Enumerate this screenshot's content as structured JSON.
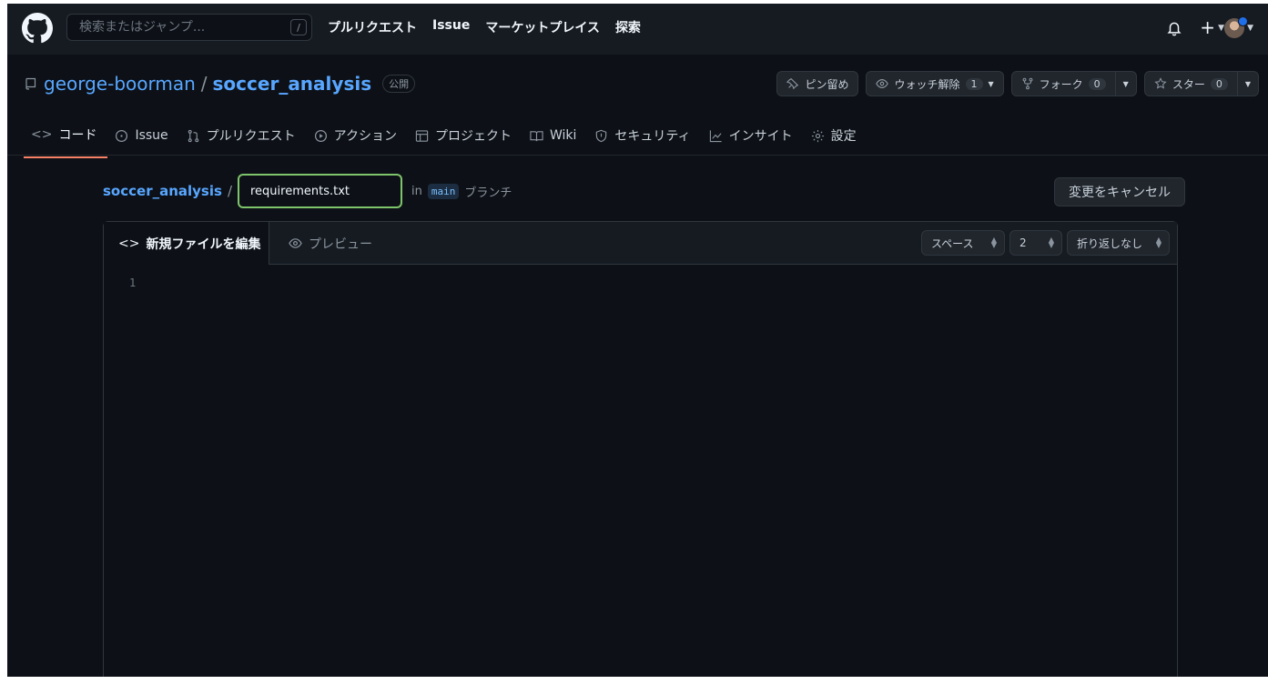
{
  "header": {
    "search_placeholder": "検索またはジャンプ...",
    "search_shortcut": "/",
    "nav": [
      "プルリクエスト",
      "Issue",
      "マーケットプレイス",
      "探索"
    ],
    "plus": "+"
  },
  "repo": {
    "owner": "george-boorman",
    "separator": "/",
    "name": "soccer_analysis",
    "visibility": "公開",
    "pin_label": "ピン留め",
    "watch_label": "ウォッチ解除",
    "watch_count": "1",
    "fork_label": "フォーク",
    "fork_count": "0",
    "star_label": "スター",
    "star_count": "0"
  },
  "tabs": [
    "コード",
    "Issue",
    "プルリクエスト",
    "アクション",
    "プロジェクト",
    "Wiki",
    "セキュリティ",
    "インサイト",
    "設定"
  ],
  "editor": {
    "breadcrumb_repo": "soccer_analysis",
    "breadcrumb_sep": "/",
    "filename": "requirements.txt",
    "in_text": "in",
    "branch": "main",
    "branch_suffix": "ブランチ",
    "cancel_label": "変更をキャンセル",
    "edit_tab": "新規ファイルを編集",
    "preview_tab": "プレビュー",
    "indent_mode": "スペース",
    "indent_size": "2",
    "wrap_mode": "折り返しなし",
    "line_number": "1"
  },
  "colors": {
    "background": "#0d1117",
    "header": "#161b22",
    "link": "#58a6ff",
    "focus_border": "#7ec46b",
    "active_tab_underline": "#f78166"
  }
}
